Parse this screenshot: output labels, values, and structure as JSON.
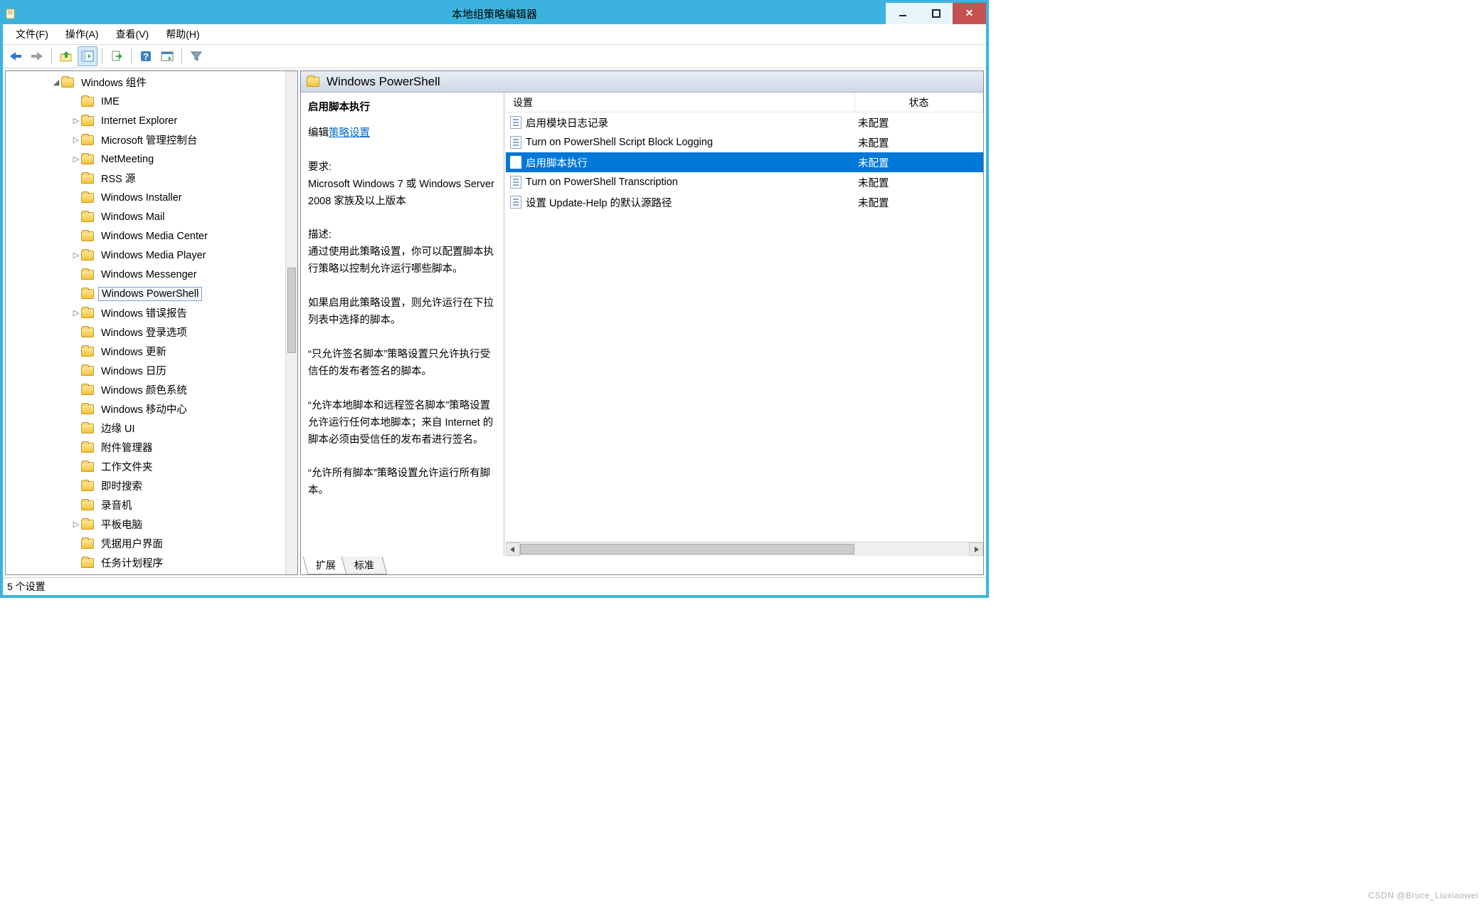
{
  "window": {
    "title": "本地组策略编辑器"
  },
  "menubar": {
    "file": "文件(F)",
    "action": "操作(A)",
    "view": "查看(V)",
    "help": "帮助(H)"
  },
  "tree": {
    "root": "Windows 组件",
    "items": [
      {
        "label": "IME",
        "expandable": false
      },
      {
        "label": "Internet Explorer",
        "expandable": true
      },
      {
        "label": "Microsoft 管理控制台",
        "expandable": true
      },
      {
        "label": "NetMeeting",
        "expandable": true
      },
      {
        "label": "RSS 源",
        "expandable": false
      },
      {
        "label": "Windows Installer",
        "expandable": false
      },
      {
        "label": "Windows Mail",
        "expandable": false
      },
      {
        "label": "Windows Media Center",
        "expandable": false
      },
      {
        "label": "Windows Media Player",
        "expandable": true
      },
      {
        "label": "Windows Messenger",
        "expandable": false
      },
      {
        "label": "Windows PowerShell",
        "expandable": false,
        "selected": true
      },
      {
        "label": "Windows 错误报告",
        "expandable": true
      },
      {
        "label": "Windows 登录选项",
        "expandable": false
      },
      {
        "label": "Windows 更新",
        "expandable": false
      },
      {
        "label": "Windows 日历",
        "expandable": false
      },
      {
        "label": "Windows 颜色系统",
        "expandable": false
      },
      {
        "label": "Windows 移动中心",
        "expandable": false
      },
      {
        "label": "边缘 UI",
        "expandable": false
      },
      {
        "label": "附件管理器",
        "expandable": false
      },
      {
        "label": "工作文件夹",
        "expandable": false
      },
      {
        "label": "即时搜索",
        "expandable": false
      },
      {
        "label": "录音机",
        "expandable": false
      },
      {
        "label": "平板电脑",
        "expandable": true
      },
      {
        "label": "凭据用户界面",
        "expandable": false
      },
      {
        "label": "任务计划程序",
        "expandable": false
      }
    ]
  },
  "header": {
    "title": "Windows PowerShell"
  },
  "description": {
    "name": "启用脚本执行",
    "edit_label": "编辑",
    "edit_link": "策略设置",
    "req_label": "要求:",
    "requirement": "Microsoft Windows 7 或 Windows Server 2008 家族及以上版本",
    "desc_label": "描述:",
    "p1": "通过使用此策略设置，你可以配置脚本执行策略以控制允许运行哪些脚本。",
    "p2": "如果启用此策略设置，则允许运行在下拉列表中选择的脚本。",
    "p3": "“只允许签名脚本”策略设置只允许执行受信任的发布者签名的脚本。",
    "p4": "“允许本地脚本和远程签名脚本”策略设置允许运行任何本地脚本；来自 Internet 的脚本必须由受信任的发布者进行签名。",
    "p5": "“允许所有脚本”策略设置允许运行所有脚本。"
  },
  "list": {
    "head_setting": "设置",
    "head_state": "状态",
    "rows": [
      {
        "name": "启用模块日志记录",
        "state": "未配置"
      },
      {
        "name": "Turn on PowerShell Script Block Logging",
        "state": "未配置"
      },
      {
        "name": "启用脚本执行",
        "state": "未配置",
        "selected": true
      },
      {
        "name": "Turn on PowerShell Transcription",
        "state": "未配置"
      },
      {
        "name": "设置 Update-Help 的默认源路径",
        "state": "未配置"
      }
    ]
  },
  "tabs": {
    "extended": "扩展",
    "standard": "标准"
  },
  "status": "5 个设置",
  "watermark": "CSDN @Bruce_Liuxiaowei"
}
